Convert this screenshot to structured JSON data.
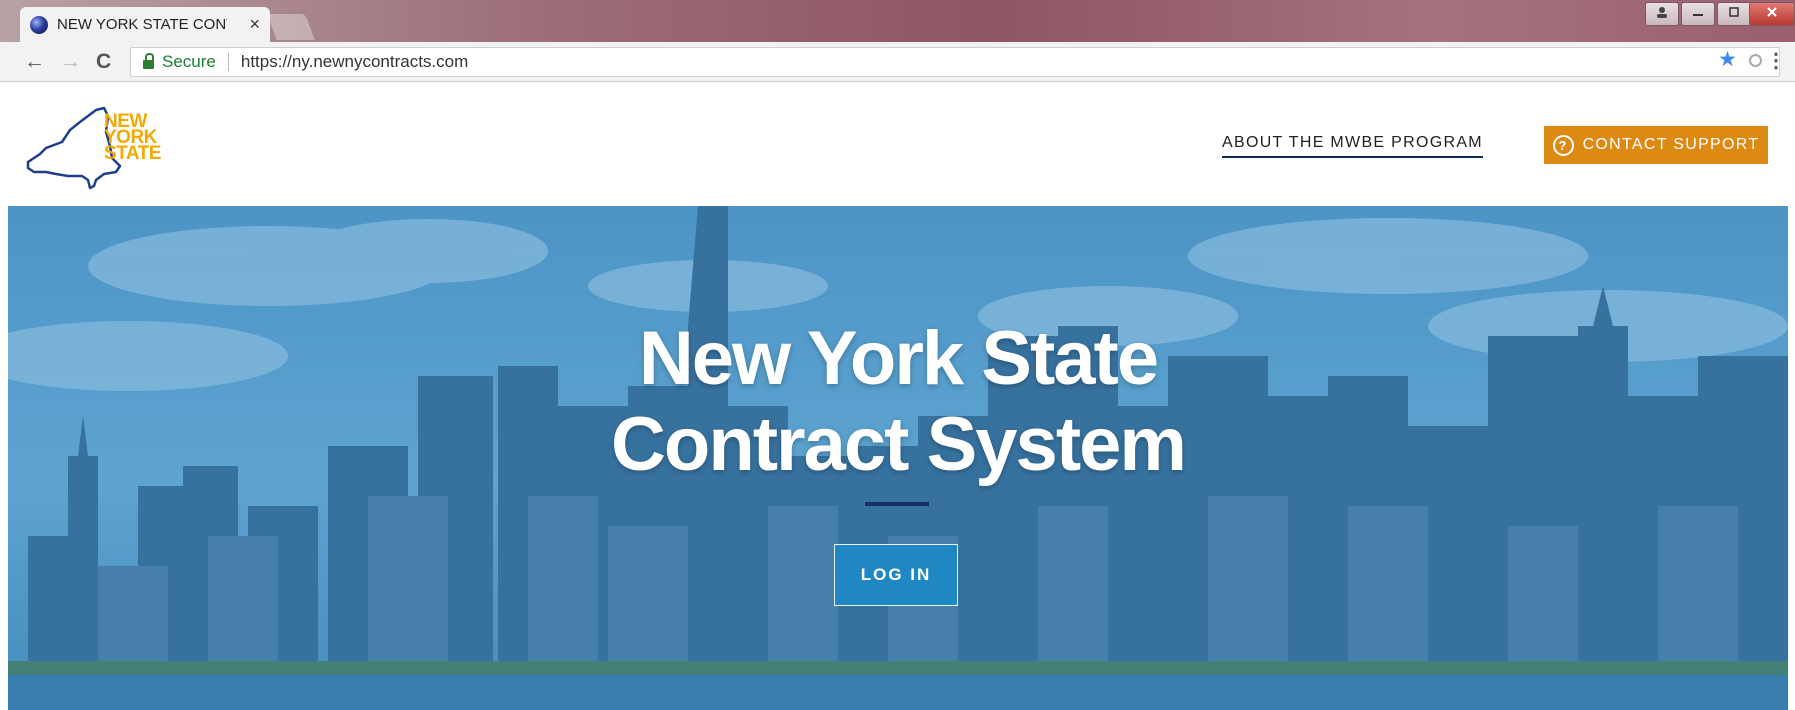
{
  "browser": {
    "tab_title": "NEW YORK STATE CONTRACT SYSTEM",
    "tab_close": "×",
    "secure_label": "Secure",
    "url": "https://ny.newnycontracts.com",
    "back_icon": "←",
    "forward_icon": "→",
    "reload_icon": "C",
    "star_icon": "★",
    "menu_icon": "⋮"
  },
  "header": {
    "logo_lines": [
      "NEW",
      "YORK",
      "STATE"
    ],
    "about_link": "ABOUT THE MWBE PROGRAM",
    "contact_button": "CONTACT SUPPORT",
    "contact_icon": "?"
  },
  "hero": {
    "title_line1": "New York State",
    "title_line2": "Contract System",
    "login_button": "LOG IN"
  },
  "colors": {
    "accent_orange": "#dc8a13",
    "logo_gold": "#f2a900",
    "logo_blue": "#1f3f8a",
    "login_blue": "#1f88c4",
    "hero_blue": "#5a9cc9"
  }
}
